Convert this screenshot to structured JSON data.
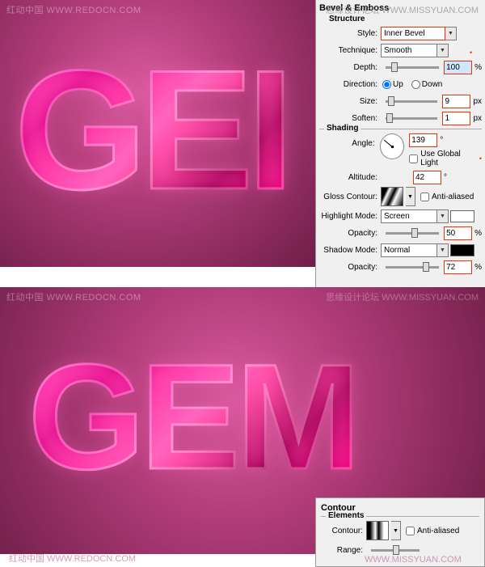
{
  "watermarks": {
    "top_left": "红动中国 WWW.REDOCN.COM",
    "top_right": "思缘设计论坛 WWW.MISSYUAN.COM",
    "bottom_left": "红动中国 WWW.REDOCN.COM",
    "bottom_right": "WWW.MISSYUAN.COM"
  },
  "preview": {
    "text_partial": "GEI",
    "text_full": "GEM"
  },
  "bevel": {
    "panel_title": "Bevel & Emboss",
    "structure": {
      "title": "Structure",
      "style": {
        "label": "Style:",
        "value": "Inner Bevel"
      },
      "technique": {
        "label": "Technique:",
        "value": "Smooth"
      },
      "depth": {
        "label": "Depth:",
        "value": "100",
        "unit": "%"
      },
      "direction": {
        "label": "Direction:",
        "up": "Up",
        "down": "Down"
      },
      "size": {
        "label": "Size:",
        "value": "9",
        "unit": "px"
      },
      "soften": {
        "label": "Soften:",
        "value": "1",
        "unit": "px"
      }
    },
    "shading": {
      "title": "Shading",
      "angle": {
        "label": "Angle:",
        "value": "139",
        "unit": "°"
      },
      "use_global": "Use Global Light",
      "altitude": {
        "label": "Altitude:",
        "value": "42",
        "unit": "°"
      },
      "gloss_contour": {
        "label": "Gloss Contour:",
        "aa": "Anti-aliased"
      },
      "highlight_mode": {
        "label": "Highlight Mode:",
        "value": "Screen"
      },
      "highlight_opacity": {
        "label": "Opacity:",
        "value": "50",
        "unit": "%"
      },
      "shadow_mode": {
        "label": "Shadow Mode:",
        "value": "Normal"
      },
      "shadow_opacity": {
        "label": "Opacity:",
        "value": "72",
        "unit": "%"
      }
    }
  },
  "contour": {
    "panel_title": "Contour",
    "elements_title": "Elements",
    "contour_label": "Contour:",
    "aa_label": "Anti-aliased",
    "range_label": "Range:"
  }
}
